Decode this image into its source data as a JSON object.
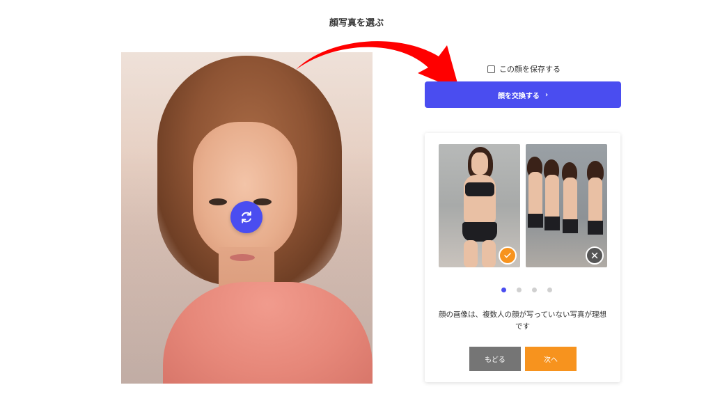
{
  "page": {
    "title": "顔写真を選ぶ"
  },
  "left_panel": {
    "photo_description_icon": "face-photo",
    "swap_button_icon": "refresh-icon"
  },
  "right_panel": {
    "save_face_label": "この顔を保存する",
    "save_face_checked": false,
    "swap_button_label": "顔を交換する",
    "swap_button_chevron": "›",
    "carousel": {
      "slides_total": 4,
      "active_index": 0,
      "examples": [
        {
          "status": "good",
          "icon": "check-icon"
        },
        {
          "status": "bad",
          "icon": "close-icon"
        }
      ]
    },
    "hint_text": "顔の画像は、複数人の顔が写っていない写真が理想です",
    "back_label": "もどる",
    "next_label": "次へ"
  },
  "colors": {
    "primary": "#4a4df0",
    "accent_orange": "#f7931e",
    "back_gray": "#757575",
    "annotation_red": "#ff0000"
  }
}
